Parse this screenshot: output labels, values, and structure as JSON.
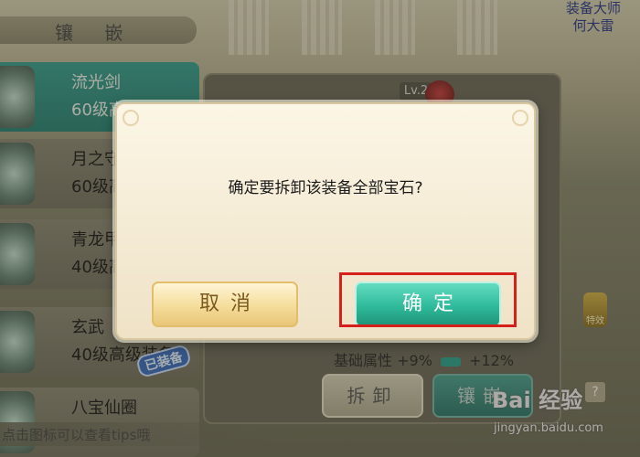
{
  "header": {
    "title": "镶 嵌",
    "npc_name_line1": "装备大师",
    "npc_name_line2": "何大雷"
  },
  "equipment_list": [
    {
      "name": "流光剑",
      "level": "60级高",
      "selected": true
    },
    {
      "name": "月之守",
      "level": "60级高"
    },
    {
      "name": "青龙甲",
      "level": "40级高"
    },
    {
      "name": "玄武",
      "level": "40级高级装备"
    },
    {
      "name": "八宝仙圈",
      "level": ""
    }
  ],
  "equipped_badge": "已装备",
  "tips": "点击图标可以查看tips哦",
  "item_panel": {
    "level_badge": "Lv.2",
    "base_attribute_label": "基础属性",
    "base_attribute_current": "+9%",
    "base_attribute_next": "+12%",
    "special_effect_label": "特效",
    "dismantle_label": "拆卸",
    "inlay_label": "镶嵌",
    "help_label": "?"
  },
  "dialog": {
    "message": "确定要拆卸该装备全部宝石?",
    "cancel_label": "取消",
    "confirm_label": "确定"
  },
  "watermark": {
    "logo": "Bai 经验",
    "url": "jingyan.baidu.com"
  },
  "colors": {
    "dialog_bg": "#f5ecd6",
    "confirm_green": "#2fba9b",
    "cancel_gold": "#f4dc9a",
    "highlight_red": "#d6201c",
    "selected_item": "#3aa292"
  }
}
